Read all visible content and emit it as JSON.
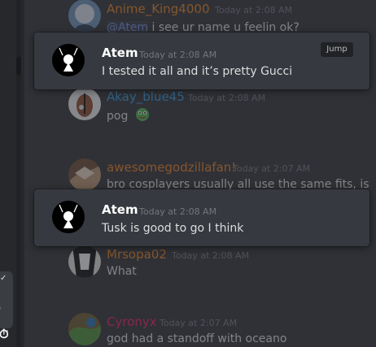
{
  "messages": [
    {
      "author": "Anime_King4000",
      "author_color": "#e67e22",
      "timestamp": "Today at 2:08 AM",
      "mention": "@Atem",
      "text": " i see ur name u feelin ok?"
    },
    {
      "author": "Akay_blue45",
      "author_color": "#3498db",
      "timestamp": "Today at 2:08 AM",
      "text": "pog",
      "emoji": "pepe-emoji"
    },
    {
      "author": "awesomegodzillafan!",
      "author_color": "#e67e22",
      "timestamp": "Today at 2:07 AM",
      "text": "bro cosplayers usually all use the same fits, is"
    },
    {
      "author": "Mrsopa02",
      "author_color": "#e67e22",
      "timestamp": "Today at 2:08 AM",
      "text": "What"
    },
    {
      "author": "Cyronyx",
      "author_color": "#e91e63",
      "timestamp": "Today at 2:07 AM",
      "text": "god had a standoff with oceano"
    }
  ],
  "popups": [
    {
      "author": "Atem",
      "timestamp": "Today at 2:08 AM",
      "text": "I tested it all and it’s pretty Gucci",
      "jump_label": "Jump"
    },
    {
      "author": "Atem",
      "timestamp": "Today at 2:08 AM",
      "text": "Tusk is good to go I think"
    }
  ],
  "left_rail": {
    "check": "✓",
    "paren": ")",
    "clock": "⏱"
  },
  "colors": {
    "background": "#2f3136",
    "popup": "#36393f",
    "text": "#dcddde",
    "muted": "#72767d"
  }
}
